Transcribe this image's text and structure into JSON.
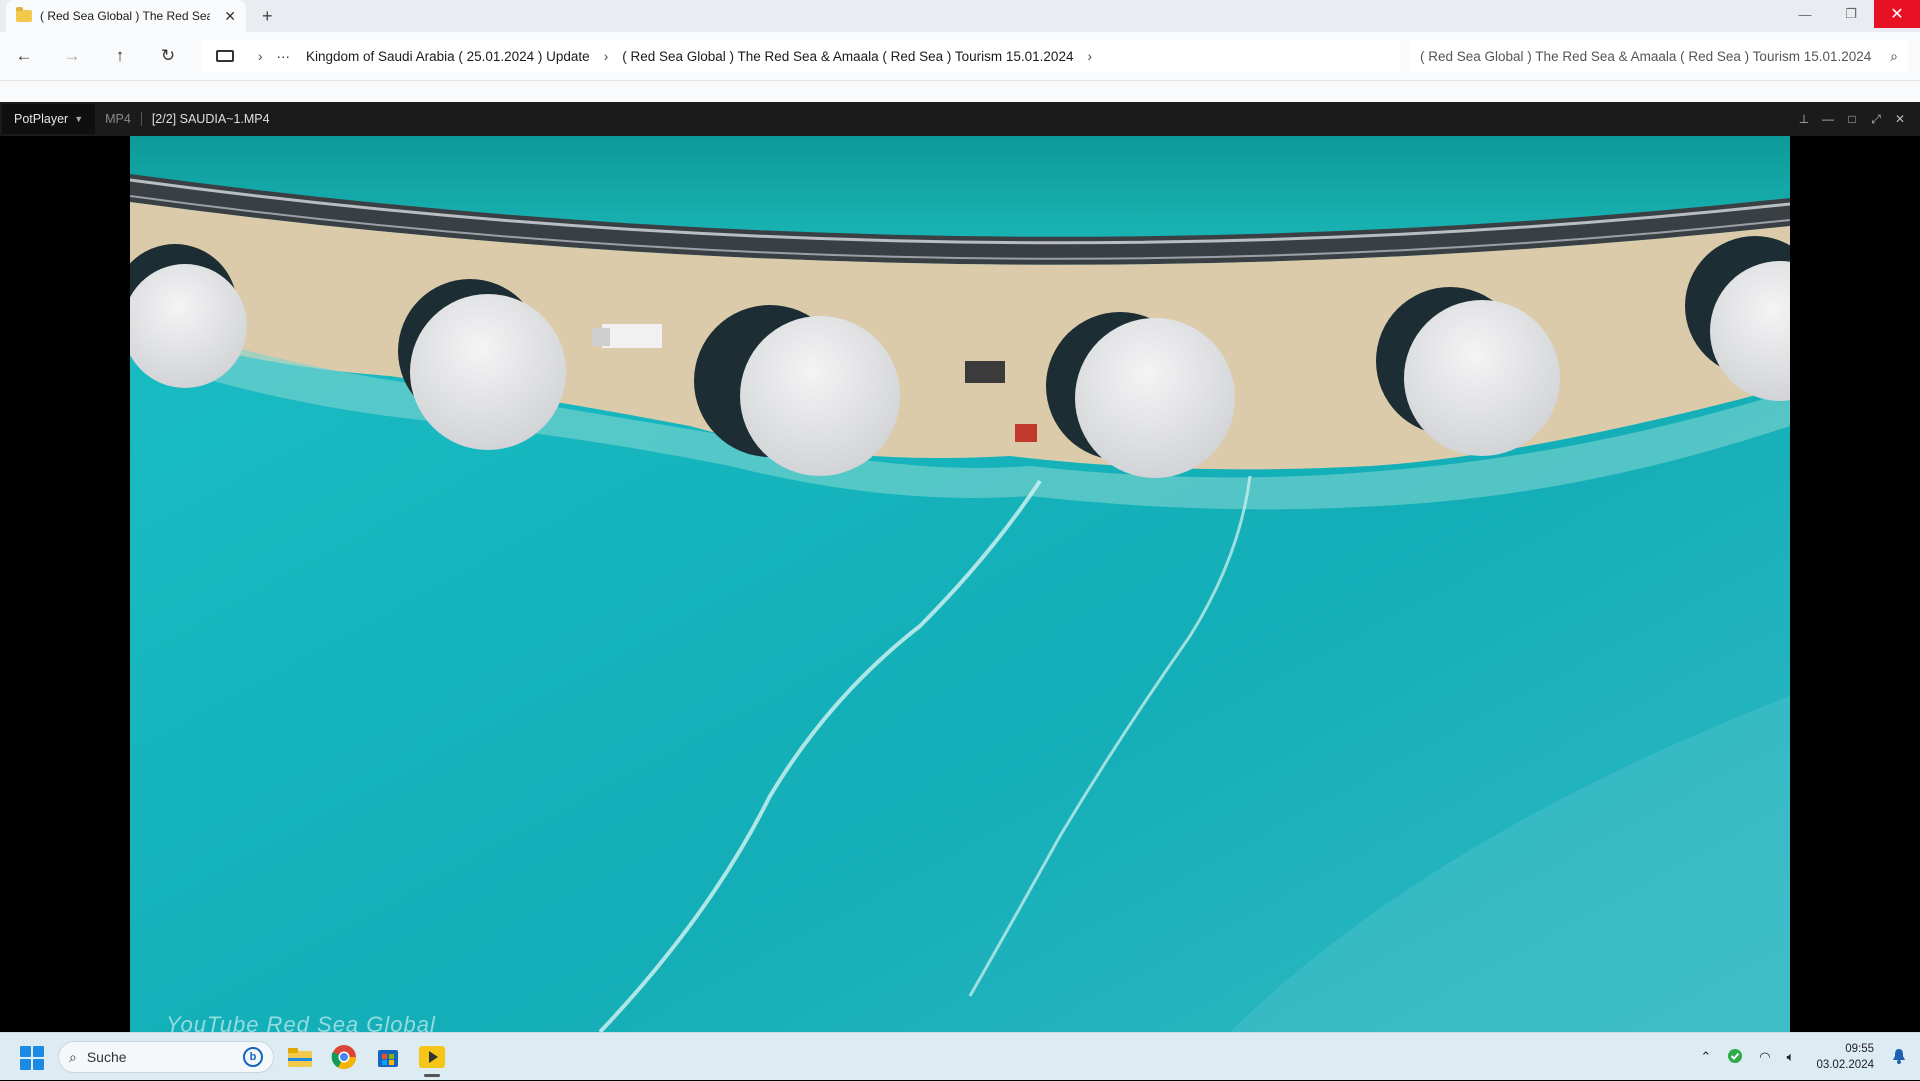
{
  "explorer": {
    "tab_title": "( Red Sea Global ) The Red Sea",
    "new_tab": "+",
    "window_controls": {
      "minimize": "—",
      "restore": "❐",
      "close": "✕"
    },
    "nav": {
      "back": "←",
      "forward": "→",
      "up": "↑",
      "refresh": "↻"
    },
    "address": {
      "more": "···",
      "crumbs": [
        "Kingdom of Saudi Arabia ( 25.01.2024 ) Update",
        "( Red Sea Global ) The Red Sea & Amaala ( Red Sea ) Tourism 15.01.2024"
      ],
      "separator": "›"
    },
    "search_value": "( Red Sea Global ) The Red Sea & Amaala ( Red Sea ) Tourism 15.01.2024"
  },
  "player": {
    "app_name": "PotPlayer",
    "format": "MP4",
    "file": "[2/2] SAUDIA~1.MP4",
    "controls": {
      "pin": "⊥",
      "minimize": "—",
      "maximize": "□",
      "fullscreen": "⤢",
      "close": "✕"
    },
    "watermark": "YouTube Red Sea Global"
  },
  "taskbar": {
    "search_placeholder": "Suche",
    "apps": [
      "file-explorer",
      "chrome",
      "microsoft-store",
      "potplayer"
    ],
    "clock_time": "09:55",
    "clock_date": "03.02.2024"
  },
  "colors": {
    "water": "#15b3bb",
    "water_deep": "#0f9aa3",
    "sand": "#d9c7a6",
    "dome": "#e6e6e8",
    "close_red": "#e81123"
  }
}
